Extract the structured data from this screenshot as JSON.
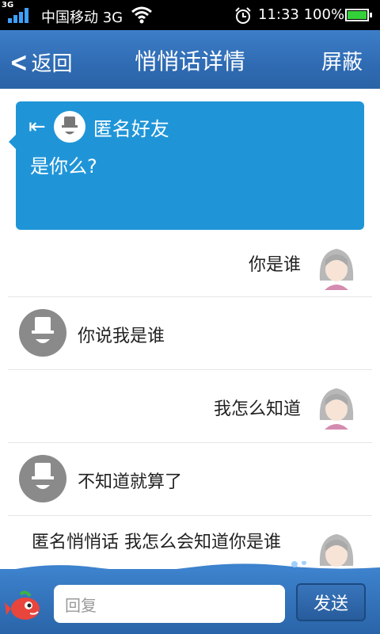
{
  "status_bar": {
    "network_badge": "3G",
    "carrier": "中国移动 3G",
    "time": "11:33",
    "battery": "100%"
  },
  "header": {
    "back_label": "返回",
    "title": "悄悄话详情",
    "action_label": "屏蔽"
  },
  "first_message": {
    "sender": "匿名好友",
    "text": "是你么?"
  },
  "messages": [
    {
      "side": "right",
      "text": "你是谁"
    },
    {
      "side": "left",
      "text": "你说我是谁"
    },
    {
      "side": "right",
      "text": "我怎么知道"
    },
    {
      "side": "left",
      "text": "不知道就算了"
    },
    {
      "side": "right",
      "text": "匿名悄悄话  我怎么会知道你是谁"
    }
  ],
  "compose": {
    "placeholder": "回复",
    "send_label": "发送"
  },
  "colors": {
    "header_blue": "#2f6bb3",
    "bubble_blue": "#1f95d8",
    "battery_green": "#35d13a"
  }
}
